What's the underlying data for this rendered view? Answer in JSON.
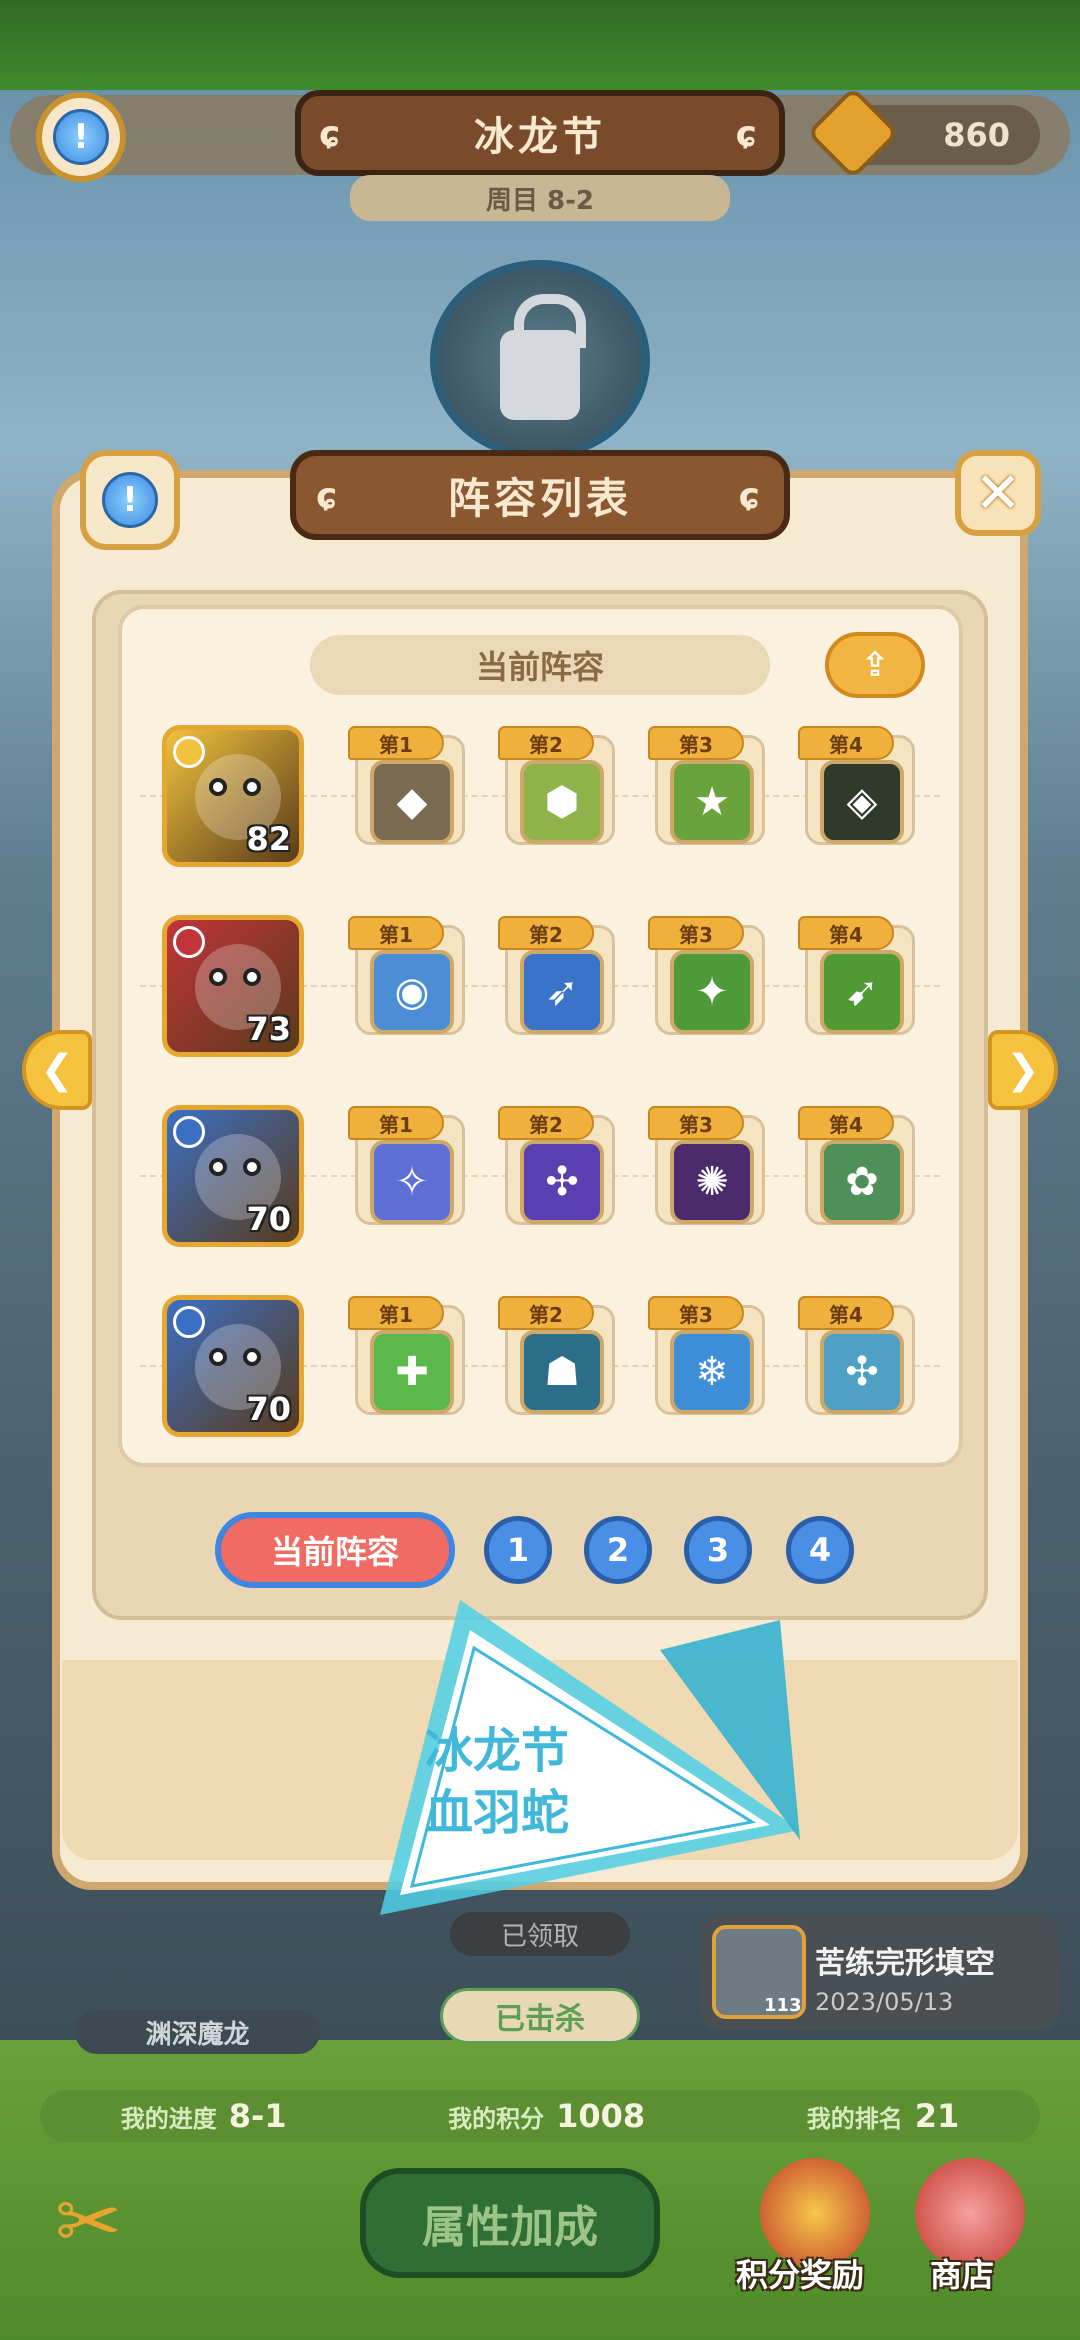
{
  "top": {
    "title": "冰龙节",
    "subtitle": "周目 8-2",
    "currency": "860"
  },
  "modal": {
    "title": "阵容列表",
    "section_title": "当前阵容",
    "close_glyph": "✕",
    "share_glyph": "⇪",
    "info_glyph": "!"
  },
  "lineup": [
    {
      "level": "82",
      "hero_color": "#f0c23d",
      "skills": [
        {
          "tag": "第1",
          "color": "#7a6a52",
          "glyph": "◆"
        },
        {
          "tag": "第2",
          "color": "#8fb34a",
          "glyph": "⬢"
        },
        {
          "tag": "第3",
          "color": "#6aa23c",
          "glyph": "★"
        },
        {
          "tag": "第4",
          "color": "#2f3a2b",
          "glyph": "◈"
        }
      ]
    },
    {
      "level": "73",
      "hero_color": "#c0343a",
      "skills": [
        {
          "tag": "第1",
          "color": "#4c8ed6",
          "glyph": "◉"
        },
        {
          "tag": "第2",
          "color": "#3a74c8",
          "glyph": "➶"
        },
        {
          "tag": "第3",
          "color": "#4e9a3a",
          "glyph": "✦"
        },
        {
          "tag": "第4",
          "color": "#4f9a33",
          "glyph": "➹"
        }
      ]
    },
    {
      "level": "70",
      "hero_color": "#3b6fc4",
      "skills": [
        {
          "tag": "第1",
          "color": "#5e6fd8",
          "glyph": "✧"
        },
        {
          "tag": "第2",
          "color": "#5a3fb0",
          "glyph": "✣"
        },
        {
          "tag": "第3",
          "color": "#4a2a6a",
          "glyph": "✺"
        },
        {
          "tag": "第4",
          "color": "#4f8f5a",
          "glyph": "✿"
        }
      ]
    },
    {
      "level": "70",
      "hero_color": "#3b6fc4",
      "skills": [
        {
          "tag": "第1",
          "color": "#5bb84a",
          "glyph": "✚"
        },
        {
          "tag": "第2",
          "color": "#2c6e8a",
          "glyph": "☗"
        },
        {
          "tag": "第3",
          "color": "#3e8ed8",
          "glyph": "❄"
        },
        {
          "tag": "第4",
          "color": "#4ea0c4",
          "glyph": "✣"
        }
      ]
    }
  ],
  "tabs": {
    "current": "当前阵容",
    "numbers": [
      "1",
      "2",
      "3",
      "4"
    ]
  },
  "watermark": {
    "line1": "冰龙节",
    "line2": "血羽蛇"
  },
  "background": {
    "received": "已领取",
    "killed": "已击杀",
    "boss_name": "渊深魔龙",
    "promo_title": "苦练完形填空",
    "promo_date": "2023/05/13",
    "promo_level": "113"
  },
  "stats": {
    "progress_label": "我的进度",
    "progress_value": "8-1",
    "score_label": "我的积分",
    "score_value": "1008",
    "rank_label": "我的排名",
    "rank_value": "21"
  },
  "bottom": {
    "attr_button": "属性加成",
    "reward_label": "积分奖励",
    "shop_label": "商店"
  }
}
